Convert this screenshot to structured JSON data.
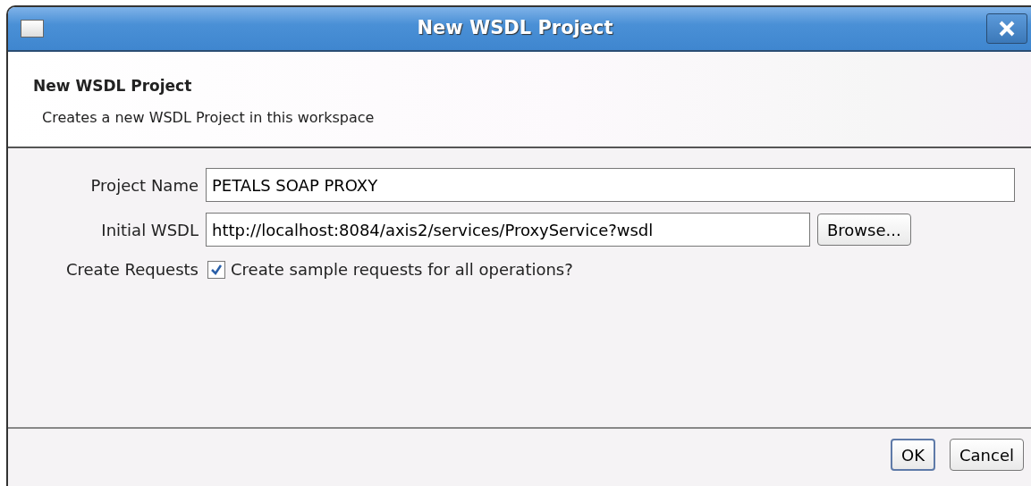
{
  "window": {
    "title": "New WSDL Project"
  },
  "header": {
    "title": "New WSDL Project",
    "description": "Creates a new WSDL Project in this workspace"
  },
  "fields": [
    {
      "kind": "text",
      "label": "Project Name",
      "value": "PETALS SOAP PROXY"
    },
    {
      "kind": "browse",
      "label": "Initial WSDL",
      "value": "http://localhost:8084/axis2/services/ProxyService?wsdl",
      "button": "Browse..."
    },
    {
      "kind": "checkbox",
      "label": "Create Requests",
      "text": "Create sample requests for all operations?",
      "checked": true
    }
  ],
  "buttons": [
    {
      "label": "OK",
      "default": true
    },
    {
      "label": "Cancel",
      "default": false
    }
  ]
}
